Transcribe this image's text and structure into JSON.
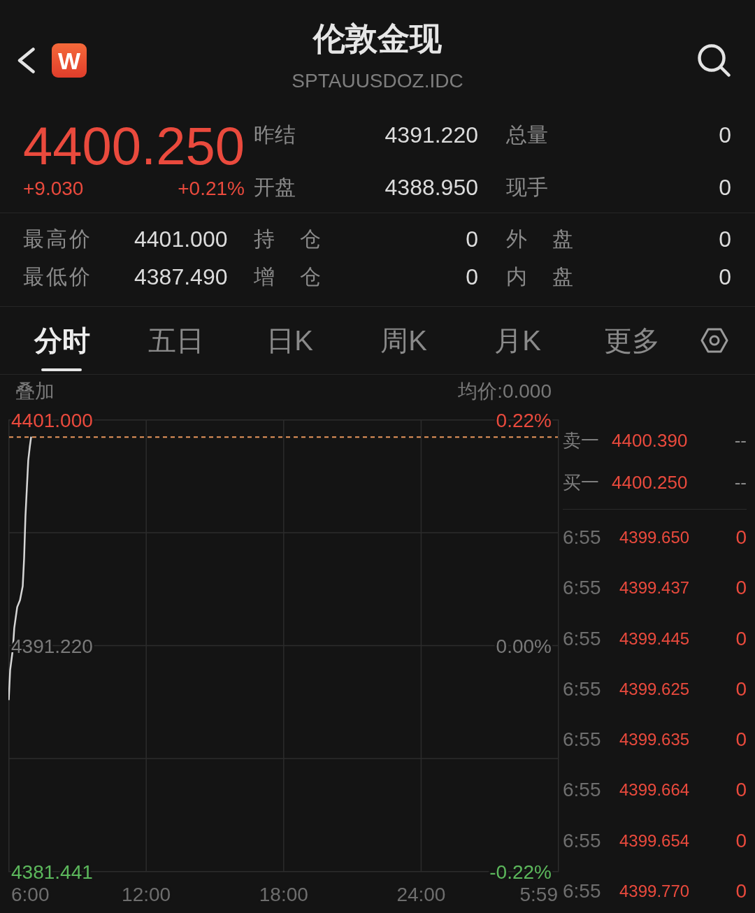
{
  "header": {
    "logo_text": "W",
    "title": "伦敦金现",
    "subtitle": "SPTAUUSDOZ.IDC"
  },
  "quote": {
    "price": "4400.250",
    "change": "+9.030",
    "change_pct": "+0.21%",
    "fields": [
      {
        "label": "昨结",
        "value": "4391.220"
      },
      {
        "label": "总量",
        "value": "0"
      },
      {
        "label": "开盘",
        "value": "4388.950"
      },
      {
        "label": "现手",
        "value": "0"
      }
    ]
  },
  "stats": [
    [
      {
        "label": "最高价",
        "value": "4401.000"
      },
      {
        "label": "持 仓",
        "value": "0"
      },
      {
        "label": "外 盘",
        "value": "0"
      }
    ],
    [
      {
        "label": "最低价",
        "value": "4387.490"
      },
      {
        "label": "增 仓",
        "value": "0"
      },
      {
        "label": "内 盘",
        "value": "0"
      }
    ]
  ],
  "tabs": [
    {
      "label": "分时",
      "selected": true
    },
    {
      "label": "五日",
      "selected": false
    },
    {
      "label": "日K",
      "selected": false
    },
    {
      "label": "周K",
      "selected": false
    },
    {
      "label": "月K",
      "selected": false
    },
    {
      "label": "更多",
      "selected": false
    }
  ],
  "chart": {
    "overlay_label": "叠加",
    "average_price": "均价:0.000",
    "percent_labels": [
      "0.22%",
      "0.00%",
      "-0.22%"
    ],
    "session_end_label": "5:59",
    "chart_data": {
      "type": "line",
      "x": [
        6.0,
        6.06,
        6.18,
        6.24,
        6.37,
        6.49,
        6.61,
        6.67,
        6.73,
        6.79,
        6.85,
        6.92,
        6.98
      ],
      "values": [
        4388.86,
        4390.16,
        4391.07,
        4391.98,
        4392.89,
        4393.19,
        4393.79,
        4395.01,
        4396.82,
        4398.03,
        4399.24,
        4399.85,
        4400.27
      ],
      "xlim": [
        6,
        29.983
      ],
      "ylim": [
        4381.441,
        4401.0
      ],
      "xticks": [
        {
          "value": 6,
          "label": "6:00"
        },
        {
          "value": 12,
          "label": "12:00"
        },
        {
          "value": 18,
          "label": "18:00"
        },
        {
          "value": 24,
          "label": "24:00"
        }
      ],
      "yticks": [
        {
          "value": 4381.441,
          "label": "4381.441"
        },
        {
          "value": 4391.22,
          "label": "4391.220"
        },
        {
          "value": 4401.0,
          "label": "4401.000"
        }
      ],
      "grid": true,
      "ref_lines": [
        {
          "axis": "y",
          "value": 4400.25
        }
      ]
    }
  },
  "order_book": [
    {
      "label": "卖一",
      "price": "4400.390",
      "volume": "--"
    },
    {
      "label": "买一",
      "price": "4400.250",
      "volume": "--"
    }
  ],
  "trades": [
    {
      "time": "6:55",
      "price": "4399.650",
      "volume": "0"
    },
    {
      "time": "6:55",
      "price": "4399.437",
      "volume": "0"
    },
    {
      "time": "6:55",
      "price": "4399.445",
      "volume": "0"
    },
    {
      "time": "6:55",
      "price": "4399.625",
      "volume": "0"
    },
    {
      "time": "6:55",
      "price": "4399.635",
      "volume": "0"
    },
    {
      "time": "6:55",
      "price": "4399.664",
      "volume": "0"
    },
    {
      "time": "6:55",
      "price": "4399.654",
      "volume": "0"
    },
    {
      "time": "6:55",
      "price": "4399.770",
      "volume": "0"
    }
  ]
}
